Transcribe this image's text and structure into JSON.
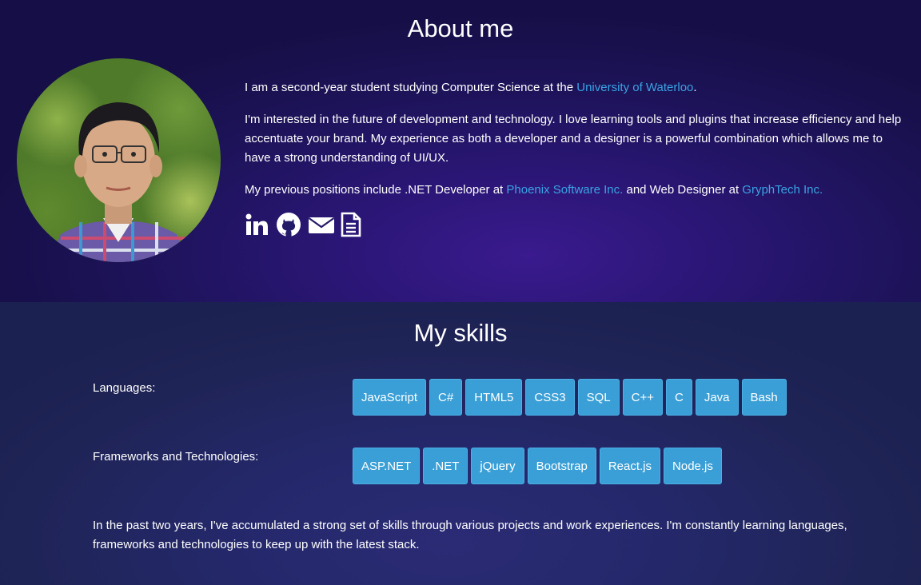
{
  "about": {
    "title": "About me",
    "p1_prefix": "I am a second-year student studying Computer Science at the ",
    "p1_link": "University of Waterloo",
    "p1_suffix": ".",
    "p2": "I'm interested in the future of development and technology. I love learning tools and plugins that increase efficiency and help accentuate your brand. My experience as both a developer and a designer is a powerful combination which allows me to have a strong understanding of UI/UX.",
    "p3_prefix": "My previous positions include .NET Developer at ",
    "p3_link1": "Phoenix Software Inc.",
    "p3_middle": " and Web Designer at ",
    "p3_link2": "GryphTech Inc.",
    "social": [
      "linkedin-icon",
      "github-icon",
      "envelope-icon",
      "document-icon"
    ]
  },
  "skills": {
    "title": "My skills",
    "languages_label": "Languages:",
    "languages": [
      "JavaScript",
      "C#",
      "HTML5",
      "CSS3",
      "SQL",
      "C++",
      "C",
      "Java",
      "Bash"
    ],
    "frameworks_label": "Frameworks and Technologies:",
    "frameworks": [
      "ASP.NET",
      ".NET",
      "jQuery",
      "Bootstrap",
      "React.js",
      "Node.js"
    ],
    "description": "In the past two years, I've accumulated a strong set of skills through various projects and work experiences. I'm constantly learning languages, frameworks and technologies to keep up with the latest stack."
  },
  "colors": {
    "link": "#3aa3e3",
    "tag": "#3a9fd6"
  }
}
